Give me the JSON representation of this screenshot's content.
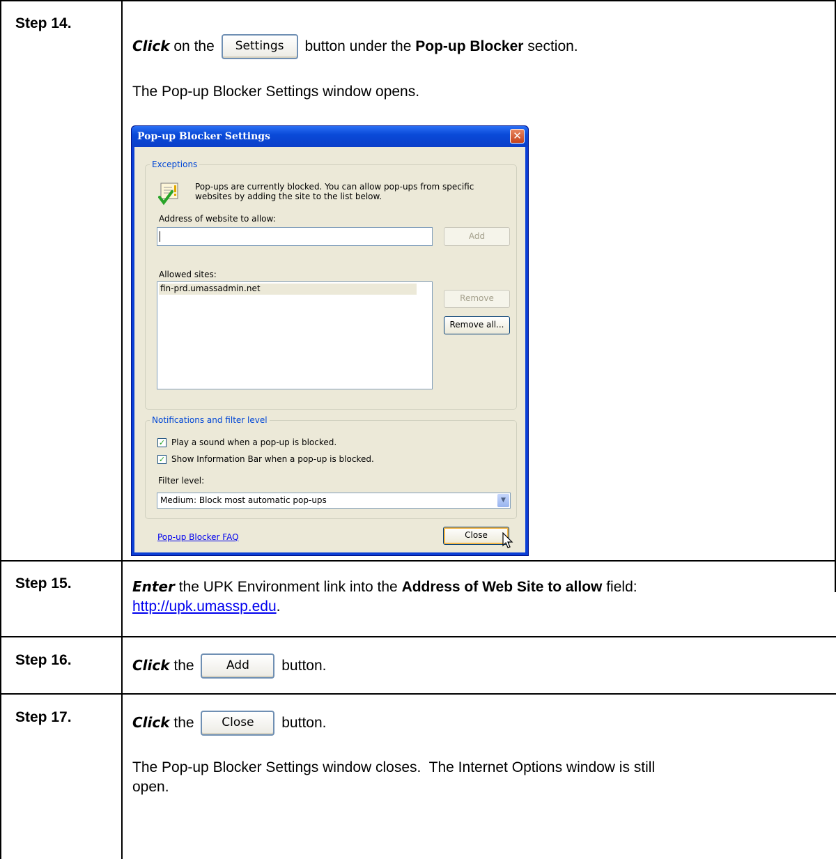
{
  "steps": [
    {
      "label": "Step 14."
    },
    {
      "label": "Step 15."
    },
    {
      "label": "Step 16."
    },
    {
      "label": "Step 17."
    }
  ],
  "step14": {
    "click_word": "Click",
    "text_on_the": " on the ",
    "settings_button": "Settings",
    "text_after_button": " button under the ",
    "section_name": "Pop-up Blocker",
    "text_section": " section.",
    "result_text": "The Pop-up Blocker Settings window opens."
  },
  "dialog": {
    "title": "Pop-up Blocker Settings",
    "close_glyph": "✕",
    "exceptions_legend": "Exceptions",
    "exceptions_desc_line1": "Pop-ups are currently blocked.  You can allow pop-ups from specific",
    "exceptions_desc_line2": "websites by adding the site to the list below.",
    "address_label": "Address of website to allow:",
    "address_value": "",
    "add_button": "Add",
    "allowed_sites_label": "Allowed sites:",
    "allowed_sites": [
      "fin-prd.umassadmin.net"
    ],
    "remove_button": "Remove",
    "remove_all_button": "Remove all...",
    "notifications_legend": "Notifications and filter level",
    "play_sound_label": "Play a sound when a pop-up is blocked.",
    "play_sound_checked": true,
    "show_infobar_label": "Show Information Bar when a pop-up is blocked.",
    "show_infobar_checked": true,
    "filter_level_label": "Filter level:",
    "filter_level_value": "Medium: Block most automatic pop-ups",
    "faq_link": "Pop-up Blocker FAQ",
    "close_button": "Close",
    "icons": {
      "info": "shield-check-icon",
      "cursor": "mouse-pointer-icon",
      "dropdown": "chevron-down-icon"
    },
    "colors": {
      "title_bar": "#0a4ad8",
      "legend": "#0046d5",
      "body": "#ece9d8"
    }
  },
  "step15": {
    "enter_word": "Enter",
    "text_before_field": " the UPK Environment link into the ",
    "field_name": "Address of Web Site to allow",
    "text_after_field": " field:",
    "link": "http://upk.umassp.edu",
    "period": "."
  },
  "step16": {
    "click_word": "Click",
    "text_the": " the ",
    "button_label": "Add",
    "text_after": " button."
  },
  "step17": {
    "click_word": "Click",
    "text_the": " the ",
    "button_label": "Close",
    "text_after": " button.",
    "result_line1": "The Pop-up Blocker Settings window closes.  The Internet Options window is still",
    "result_line2": "open."
  }
}
